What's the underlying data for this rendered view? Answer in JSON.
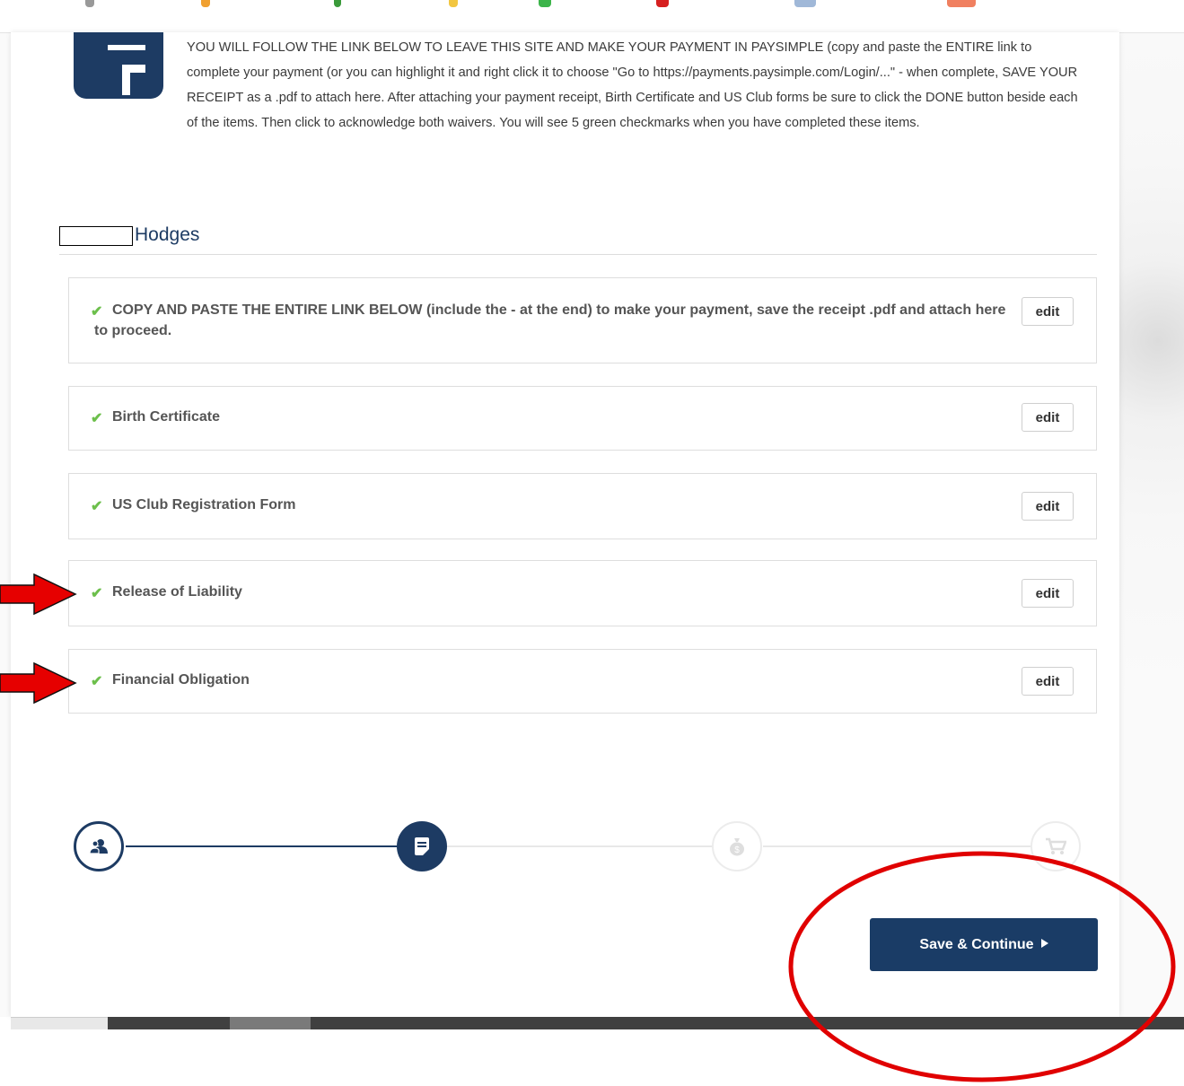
{
  "instructions": {
    "text": "YOU WILL FOLLOW THE LINK BELOW TO LEAVE THIS SITE AND MAKE YOUR PAYMENT IN PAYSIMPLE (copy and paste the ENTIRE link to complete your payment (or you can highlight it and right click it to choose \"Go to https://payments.paysimple.com/Login/...\" - when complete, SAVE YOUR RECEIPT as a .pdf to attach here. After attaching your payment receipt, Birth Certificate and US Club forms be sure to click the DONE button beside each of the items. Then click to acknowledge both waivers. You will see 5 green checkmarks when you have completed these items."
  },
  "family": {
    "last_name": "Hodges"
  },
  "items": [
    {
      "status": "complete",
      "check": "✔",
      "label": "COPY AND PASTE THE ENTIRE LINK BELOW (include the - at the end) to make your payment, save the receipt .pdf and attach here to proceed.",
      "action": "edit"
    },
    {
      "status": "complete",
      "check": "✔",
      "label": "Birth Certificate",
      "action": "edit"
    },
    {
      "status": "complete",
      "check": "✔",
      "label": "US Club Registration Form",
      "action": "edit"
    },
    {
      "status": "complete",
      "check": "✔",
      "label": "Release of Liability",
      "action": "edit"
    },
    {
      "status": "complete",
      "check": "✔",
      "label": "Financial Obligation",
      "action": "edit"
    }
  ],
  "stepper": {
    "current_step": 2,
    "steps": [
      {
        "icon": "users-icon",
        "state": "completed"
      },
      {
        "icon": "document-icon",
        "state": "active"
      },
      {
        "icon": "money-bag-icon",
        "state": "upcoming"
      },
      {
        "icon": "cart-icon",
        "state": "upcoming"
      }
    ]
  },
  "footer": {
    "save_label": "Save & Continue"
  },
  "colors": {
    "primary": "#1d3b63",
    "check": "#6cbf4b",
    "annotation": "#e00000"
  }
}
